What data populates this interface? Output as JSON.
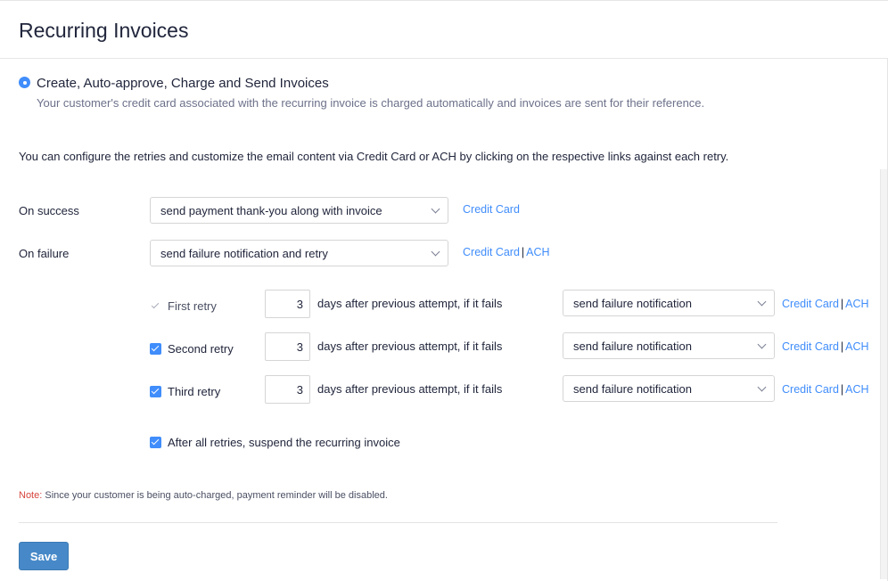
{
  "header": {
    "title": "Recurring Invoices"
  },
  "option": {
    "title": "Create, Auto-approve, Charge and Send Invoices",
    "description": "Your customer's credit card associated with the recurring invoice is charged automatically and invoices are sent for their reference."
  },
  "info_text": "You can configure the retries and customize the email content via Credit Card or ACH by clicking on the respective links against each retry.",
  "on_success": {
    "label": "On success",
    "value": "send payment thank-you along with invoice",
    "link_credit_card": "Credit Card"
  },
  "on_failure": {
    "label": "On failure",
    "value": "send failure notification and retry",
    "link_credit_card": "Credit Card",
    "separator": "|",
    "link_ach": "ACH"
  },
  "retries": [
    {
      "label": "First retry",
      "checked": true,
      "disabled": true,
      "days": "3",
      "days_text": "days after previous attempt, if it fails",
      "action": "send failure notification",
      "link_credit_card": "Credit Card",
      "separator": "|",
      "link_ach": "ACH"
    },
    {
      "label": "Second retry",
      "checked": true,
      "disabled": false,
      "days": "3",
      "days_text": "days after previous attempt, if it fails",
      "action": "send failure notification",
      "link_credit_card": "Credit Card",
      "separator": "|",
      "link_ach": "ACH"
    },
    {
      "label": "Third retry",
      "checked": true,
      "disabled": false,
      "days": "3",
      "days_text": "days after previous attempt, if it fails",
      "action": "send failure notification",
      "link_credit_card": "Credit Card",
      "separator": "|",
      "link_ach": "ACH"
    }
  ],
  "suspend": {
    "label": "After all retries, suspend the recurring invoice",
    "checked": true
  },
  "note": {
    "label": "Note:",
    "text": " Since your customer is being auto-charged, payment reminder will be disabled."
  },
  "save_label": "Save",
  "colors": {
    "accent": "#408dfb",
    "save_button": "#4789c8",
    "note_label": "#d6453d"
  }
}
